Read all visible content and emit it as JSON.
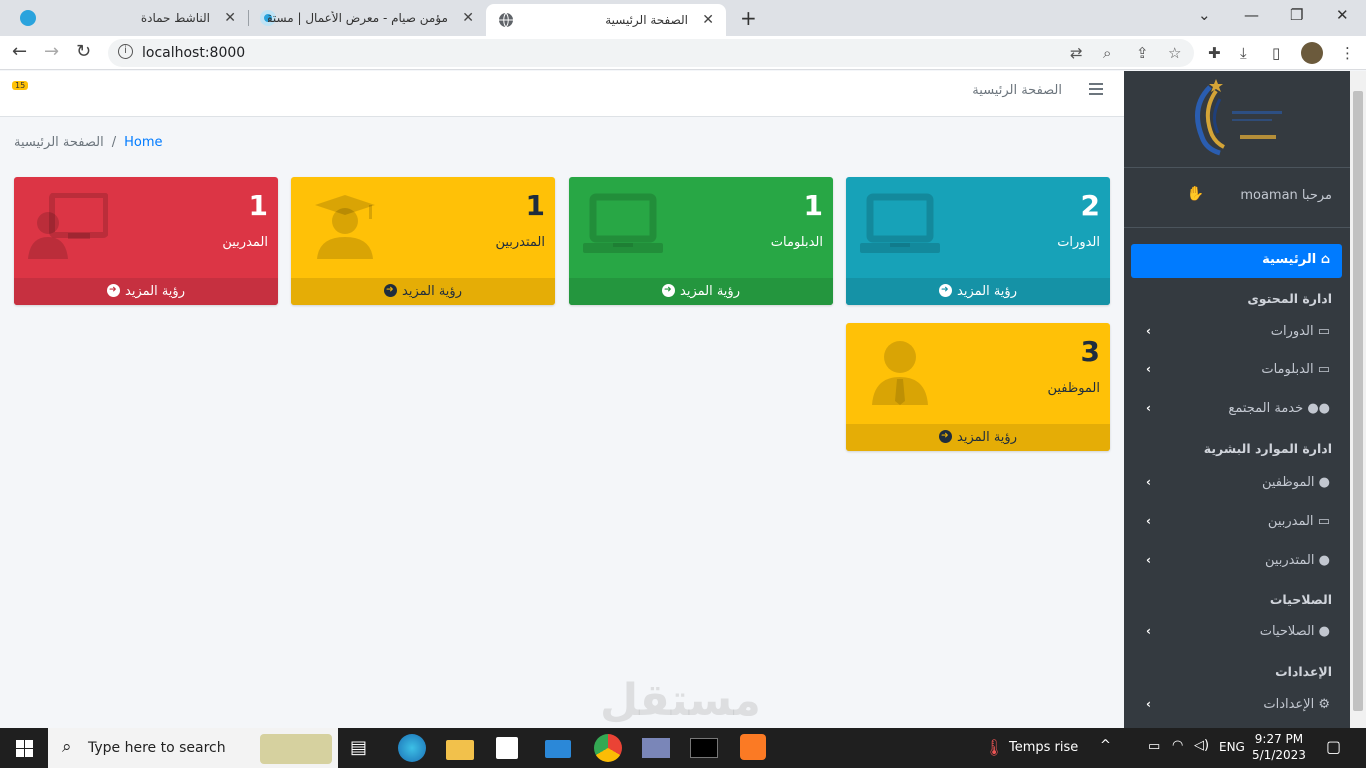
{
  "browser": {
    "tabs": [
      {
        "title": "الناشط حمادة"
      },
      {
        "title": "مؤمن صيام - معرض الأعمال | مستقل"
      },
      {
        "title": "الصفحة الرئيسية"
      }
    ],
    "url": "localhost:8000"
  },
  "navbar": {
    "title": "الصفحة الرئيسية",
    "notif_badge": "15"
  },
  "breadcrumb": {
    "home": "Home",
    "separator": "/",
    "current": "الصفحة الرئيسية"
  },
  "cards": [
    {
      "count": "2",
      "label": "الدورات",
      "more": "رؤية المزيد",
      "color": "#17a2b8",
      "footer_color": "#1592a6",
      "icon": "laptop-icon"
    },
    {
      "count": "1",
      "label": "الدبلومات",
      "more": "رؤية المزيد",
      "color": "#28a745",
      "footer_color": "#24963e",
      "icon": "laptop-icon"
    },
    {
      "count": "1",
      "label": "المتدربين",
      "more": "رؤية المزيد",
      "color": "#ffc107",
      "footer_color": "#e5ad06",
      "icon": "user-graduate-icon"
    },
    {
      "count": "1",
      "label": "المدربين",
      "more": "رؤية المزيد",
      "color": "#dc3545",
      "footer_color": "#c63040",
      "icon": "chalkboard-teacher-icon"
    },
    {
      "count": "3",
      "label": "الموظفين",
      "more": "رؤية المزيد",
      "color": "#ffc107",
      "footer_color": "#e5ad06",
      "icon": "user-tie-icon"
    }
  ],
  "sidebar": {
    "greeting": "مرحبا moaman",
    "home": "الرئيسية",
    "headers": [
      "ادارة المحتوى",
      "ادارة الموارد البشرية",
      "الصلاحيات",
      "الإعدادات"
    ],
    "items": [
      {
        "label": "الدورات",
        "icon": "laptop-icon"
      },
      {
        "label": "الدبلومات",
        "icon": "laptop-icon"
      },
      {
        "label": "خدمة المجتمع",
        "icon": "users-icon"
      },
      {
        "label": "الموظفين",
        "icon": "user-tie-icon"
      },
      {
        "label": "المدربين",
        "icon": "chalkboard-teacher-icon"
      },
      {
        "label": "المتدربين",
        "icon": "user-graduate-icon"
      },
      {
        "label": "الصلاحيات",
        "icon": "user-lock-icon"
      },
      {
        "label": "الإعدادات",
        "icon": "gear-icon"
      }
    ]
  },
  "taskbar": {
    "search_placeholder": "Type here to search",
    "weather": "Temps rise",
    "lang": "ENG",
    "time": "9:27 PM",
    "date": "5/1/2023"
  },
  "watermark": "مستقل"
}
